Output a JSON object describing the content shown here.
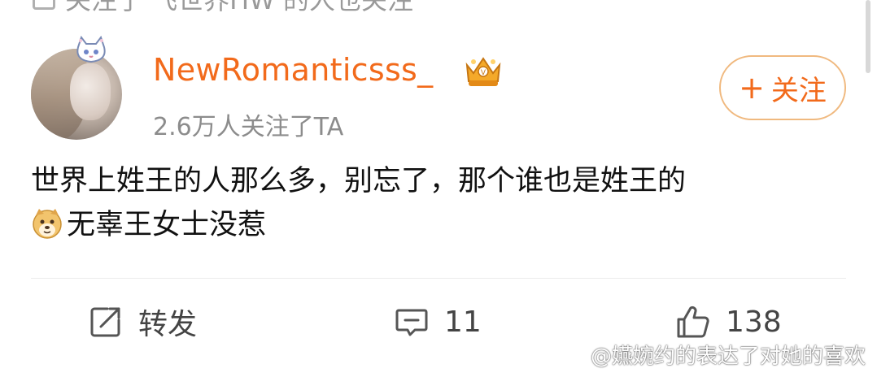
{
  "header_cut": {
    "text": "关注了 飞世界HW 的人也关注"
  },
  "post": {
    "username": "NewRomanticsss_",
    "follower_info": "2.6万人关注了TA",
    "follow_button": {
      "plus": "+",
      "label": "关注"
    },
    "content_line1": "世界上姓王的人那么多，别忘了，那个谁也是姓王的",
    "content_line2": "无辜王女士没惹"
  },
  "actions": {
    "repost_label": "转发",
    "comment_count": "11",
    "like_count": "138"
  },
  "watermark": {
    "text": "@嬿婉约的表达了对她的喜欢"
  },
  "colors": {
    "username": "#f26a1b",
    "follow_border": "#f0b97f",
    "muted": "#8c8c8c"
  },
  "icons": [
    "crown-badge-icon",
    "cat-avatar-pendant-icon",
    "doge-emoji-icon",
    "repost-icon",
    "comment-icon",
    "like-icon",
    "weibo-logo-icon"
  ]
}
